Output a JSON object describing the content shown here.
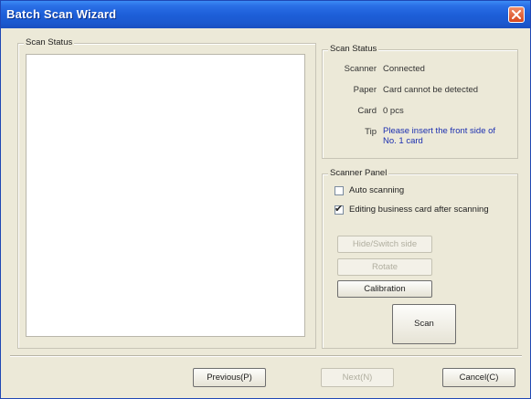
{
  "window": {
    "title": "Batch Scan Wizard"
  },
  "left_group": {
    "legend": "Scan Status"
  },
  "right_status": {
    "legend": "Scan Status",
    "scanner_label": "Scanner",
    "scanner_value": "Connected",
    "paper_label": "Paper",
    "paper_value": "Card cannot be detected",
    "card_label": "Card",
    "card_value": "0 pcs",
    "tip_label": "Tip",
    "tip_line1": "Please insert the front side of",
    "tip_line2": "No. 1 card"
  },
  "scanner_panel": {
    "legend": "Scanner Panel",
    "auto_scanning": {
      "label": "Auto scanning",
      "checked": false
    },
    "editing_after": {
      "label": "Editing business card after scanning",
      "checked": true
    },
    "side_button": "Hide/Switch side",
    "rotate_button": "Rotate",
    "calibration_button": "Calibration",
    "scan_button": "Scan"
  },
  "footer": {
    "previous": "Previous(P)",
    "next": "Next(N)",
    "cancel": "Cancel(C)"
  },
  "colors": {
    "title_bar": "#1d5fd9",
    "tip_text": "#1c2fb0",
    "close_button": "#d6481f",
    "window_bg": "#ece9d8"
  },
  "icons": {
    "close": "close-icon",
    "check": "check-icon"
  }
}
